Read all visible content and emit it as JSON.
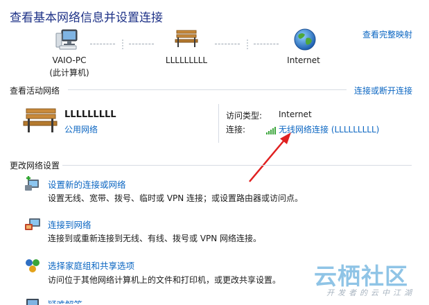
{
  "page": {
    "title": "查看基本网络信息并设置连接",
    "view_full_map": "查看完整映射"
  },
  "network_map": {
    "computer_name": "VAIO-PC",
    "computer_sub": "(此计算机)",
    "network_name": "LLLLLLLLL",
    "internet_label": "Internet",
    "icons": [
      "computer-icon",
      "bench-icon",
      "globe-icon"
    ]
  },
  "active_networks": {
    "section_title": "查看活动网络",
    "connect_disconnect": "连接或断开连接",
    "network_name": "LLLLLLLLL",
    "network_type": "公用网络",
    "access_type_label": "访问类型:",
    "access_type_value": "Internet",
    "connection_label": "连接:",
    "connection_value": "无线网络连接 (LLLLLLLLL)"
  },
  "change_settings": {
    "section_title": "更改网络设置",
    "tasks": [
      {
        "title": "设置新的连接或网络",
        "desc": "设置无线、宽带、拨号、临时或 VPN 连接；或设置路由器或访问点。",
        "icon": "new-connection-icon"
      },
      {
        "title": "连接到网络",
        "desc": "连接到或重新连接到无线、有线、拨号或 VPN 网络连接。",
        "icon": "connect-network-icon"
      },
      {
        "title": "选择家庭组和共享选项",
        "desc": "访问位于其他网络计算机上的文件和打印机，或更改共享设置。",
        "icon": "homegroup-icon"
      },
      {
        "title": "疑难解答",
        "desc": "",
        "icon": "troubleshoot-icon"
      }
    ]
  },
  "watermark": {
    "text": "云栖社区",
    "sub": "开发者的云中江湖"
  },
  "colors": {
    "title": "#1e3287",
    "link": "#0b66c2",
    "arrow": "#e02020"
  }
}
